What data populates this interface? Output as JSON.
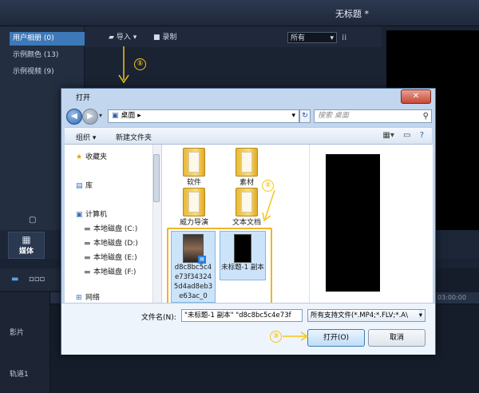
{
  "app": {
    "title": "无标题 *"
  },
  "library": {
    "items": [
      {
        "label": "用户相册 (0)",
        "active": true
      },
      {
        "label": "示例颜色 (13)",
        "active": false
      },
      {
        "label": "示例视频 (9)",
        "active": false
      }
    ]
  },
  "toolbar": {
    "import_label": "导入",
    "record_label": "录制",
    "filter_value": "所有"
  },
  "media_tab": {
    "label": "媒体"
  },
  "timeline": {
    "track1_label": "影片",
    "track2_label": "轨道1",
    "ruler_time": "03:00:00"
  },
  "annotations": {
    "step1": "①",
    "step2": "②",
    "step3": "③"
  },
  "dialog": {
    "title": "打开",
    "close_label": "✕",
    "address": "桌面",
    "search_placeholder": "搜索 桌面",
    "organize_label": "组织 ▾",
    "new_folder_label": "新建文件夹",
    "nav": {
      "favorites": "收藏夹",
      "libraries": "库",
      "computer": "计算机",
      "drives": [
        "本地磁盘 (C:)",
        "本地磁盘 (D:)",
        "本地磁盘 (E:)",
        "本地磁盘 (F:)"
      ],
      "network": "网络"
    },
    "files": [
      {
        "name": "软件"
      },
      {
        "name": "素材"
      },
      {
        "name": "威力导演"
      },
      {
        "name": "文本文档"
      },
      {
        "name": "d8c8bc5c4e73f343245d4ad8eb3e63ac_0"
      },
      {
        "name": "未标题-1 副本"
      }
    ],
    "filename_label": "文件名(N):",
    "filename_value": "\"未标题-1 副本\" \"d8c8bc5c4e73f",
    "filetype_value": "所有支持文件(*.MP4;*.FLV;*.A\\",
    "open_label": "打开(O)",
    "cancel_label": "取消"
  }
}
